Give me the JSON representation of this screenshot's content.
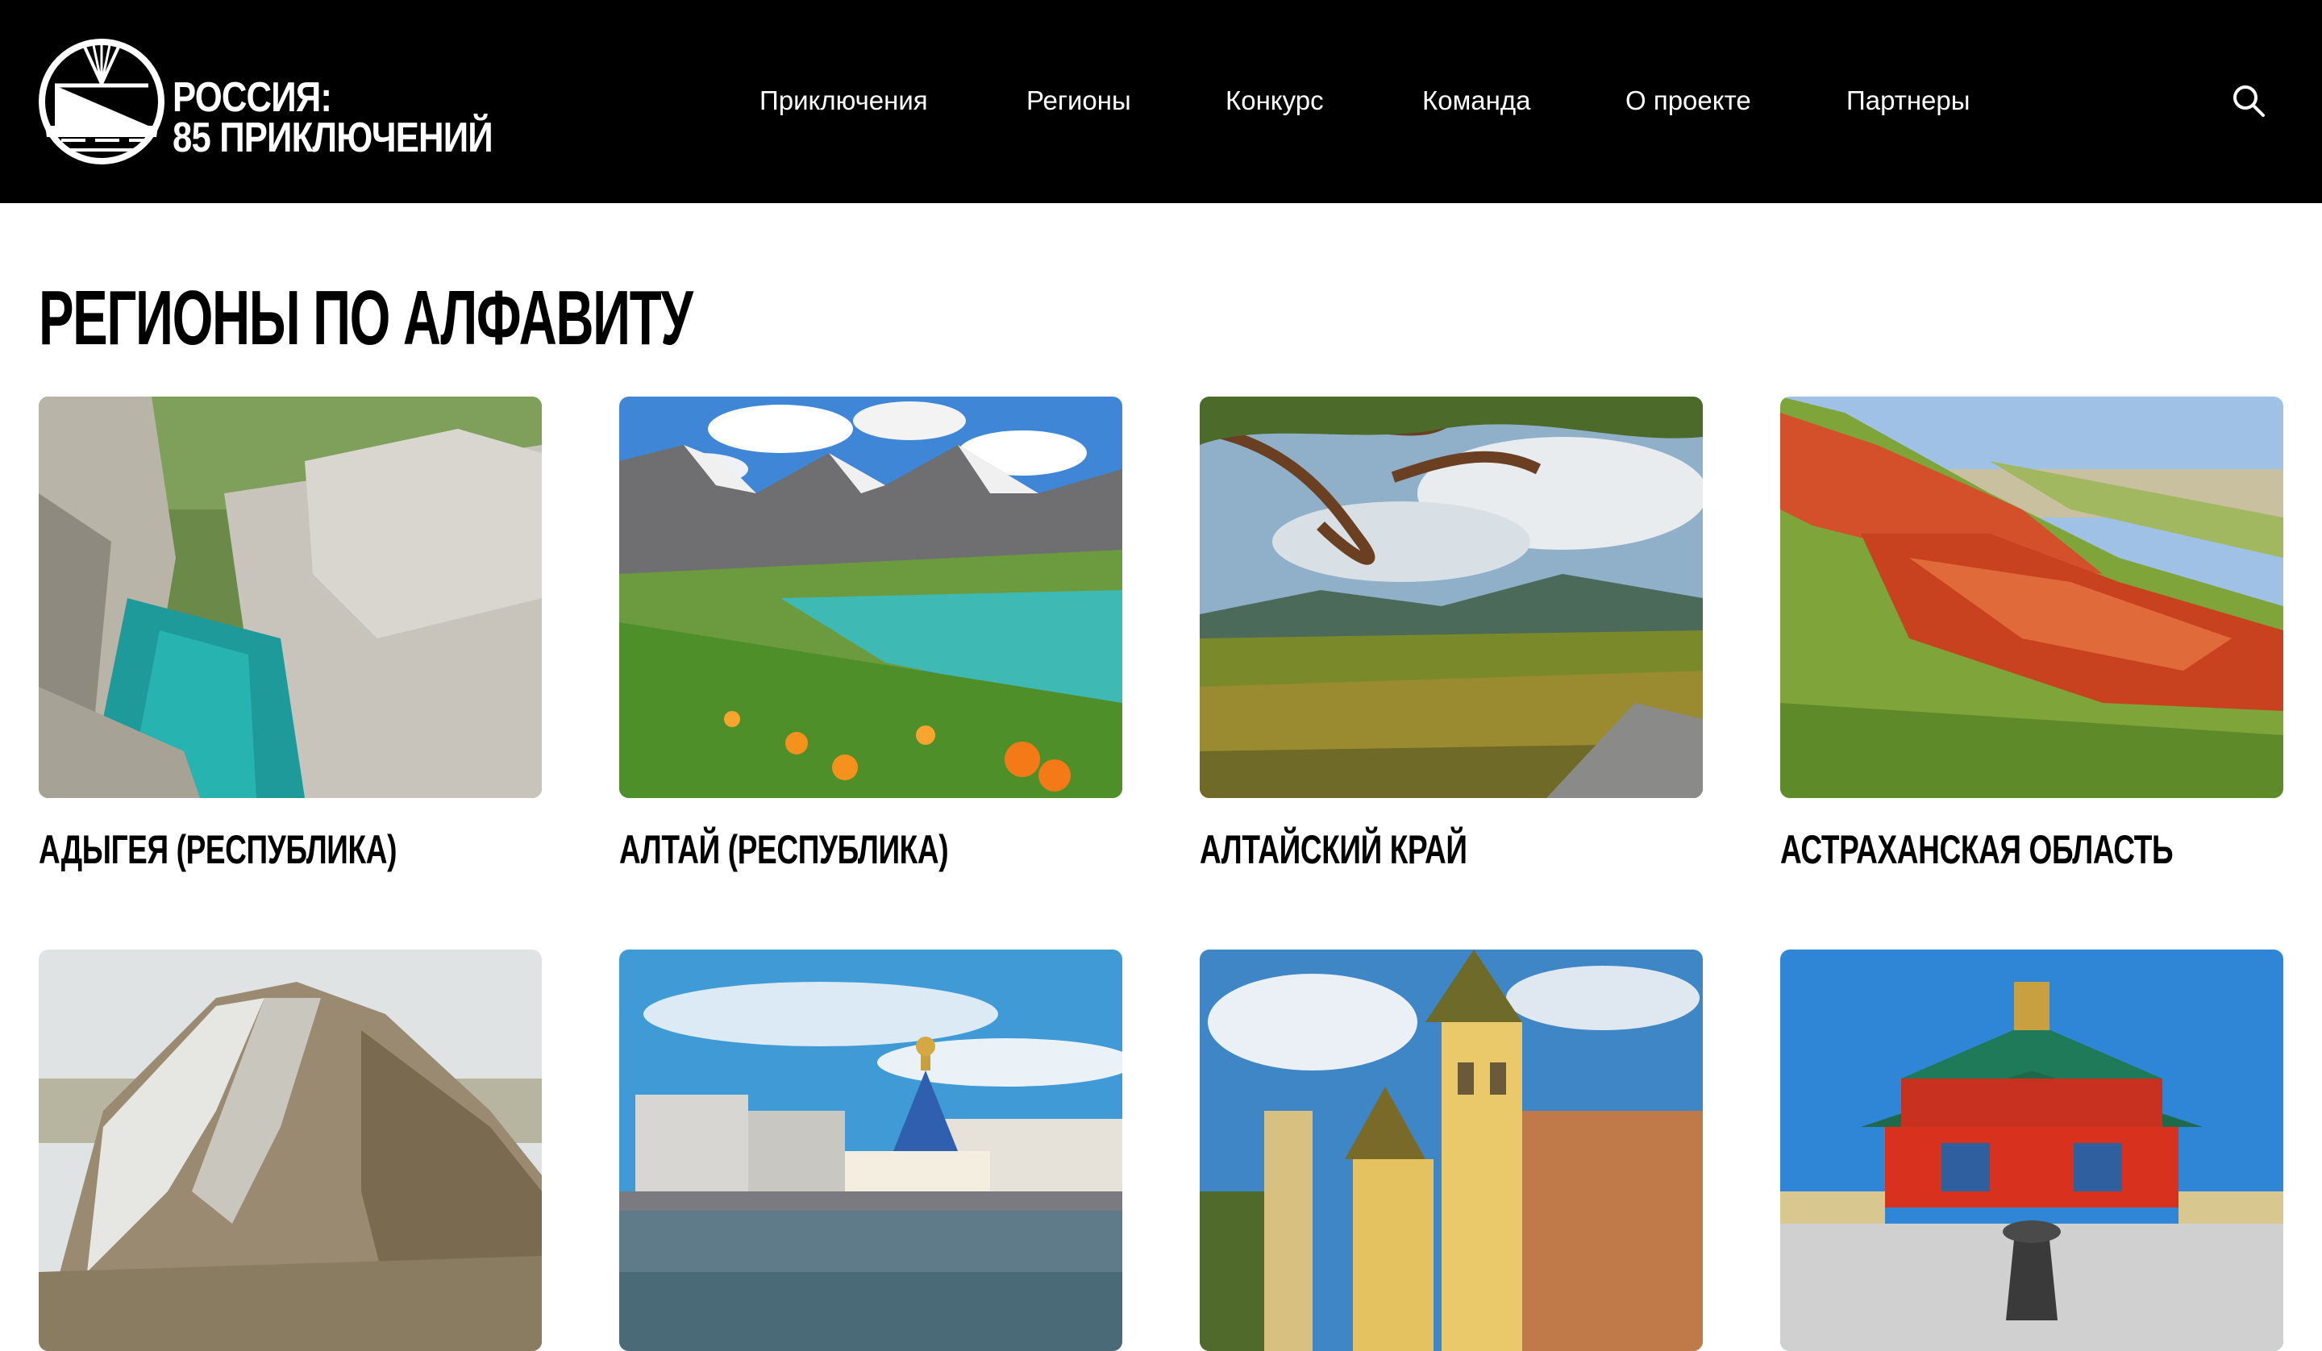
{
  "header": {
    "logo": {
      "line1": "РОССИЯ:",
      "line2": "85 ПРИКЛЮЧЕНИЙ"
    },
    "nav": [
      {
        "label": "Приключения"
      },
      {
        "label": "Регионы"
      },
      {
        "label": "Конкурс"
      },
      {
        "label": "Команда"
      },
      {
        "label": "О проекте"
      },
      {
        "label": "Партнеры"
      }
    ],
    "search_icon": "search-icon"
  },
  "main": {
    "title": "Регионы по алфавиту",
    "regions": [
      {
        "name": "Адыгея (Республика)",
        "image": "river-canyon"
      },
      {
        "name": "Алтай (Республика)",
        "image": "mountain-lake-flowers"
      },
      {
        "name": "Алтайский край",
        "image": "tree-over-valley"
      },
      {
        "name": "Астраханская область",
        "image": "red-hills"
      },
      {
        "name": "",
        "image": "rocky-hill"
      },
      {
        "name": "",
        "image": "city-church-river"
      },
      {
        "name": "",
        "image": "yellow-church"
      },
      {
        "name": "",
        "image": "buddhist-temple"
      }
    ]
  },
  "colors": {
    "header_bg": "#000000",
    "page_bg": "#ffffff",
    "text": "#000000",
    "header_text": "#ffffff"
  }
}
